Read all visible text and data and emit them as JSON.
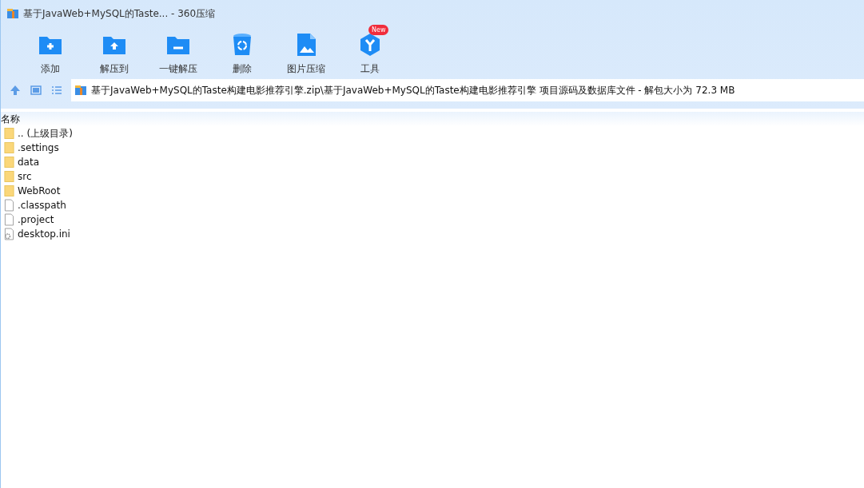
{
  "window": {
    "title": "基于JavaWeb+MySQL的Taste... - 360压缩"
  },
  "toolbar": [
    {
      "label": "添加",
      "kind": "add"
    },
    {
      "label": "解压到",
      "kind": "extract"
    },
    {
      "label": "一键解压",
      "kind": "oneclick"
    },
    {
      "label": "删除",
      "kind": "delete"
    },
    {
      "label": "图片压缩",
      "kind": "image"
    },
    {
      "label": "工具",
      "kind": "tools",
      "badge": "New"
    }
  ],
  "address_bar": {
    "path": "基于JavaWeb+MySQL的Taste构建电影推荐引擎.zip\\基于JavaWeb+MySQL的Taste构建电影推荐引擎 项目源码及数据库文件 - 解包大小为 72.3 MB"
  },
  "file_list": {
    "columns": [
      "名称"
    ],
    "rows": [
      {
        "name": ".. (上级目录)",
        "kind": "folder"
      },
      {
        "name": ".settings",
        "kind": "folder"
      },
      {
        "name": "data",
        "kind": "folder"
      },
      {
        "name": "src",
        "kind": "folder"
      },
      {
        "name": "WebRoot",
        "kind": "folder"
      },
      {
        "name": ".classpath",
        "kind": "file"
      },
      {
        "name": ".project",
        "kind": "file"
      },
      {
        "name": "desktop.ini",
        "kind": "settings"
      }
    ]
  }
}
